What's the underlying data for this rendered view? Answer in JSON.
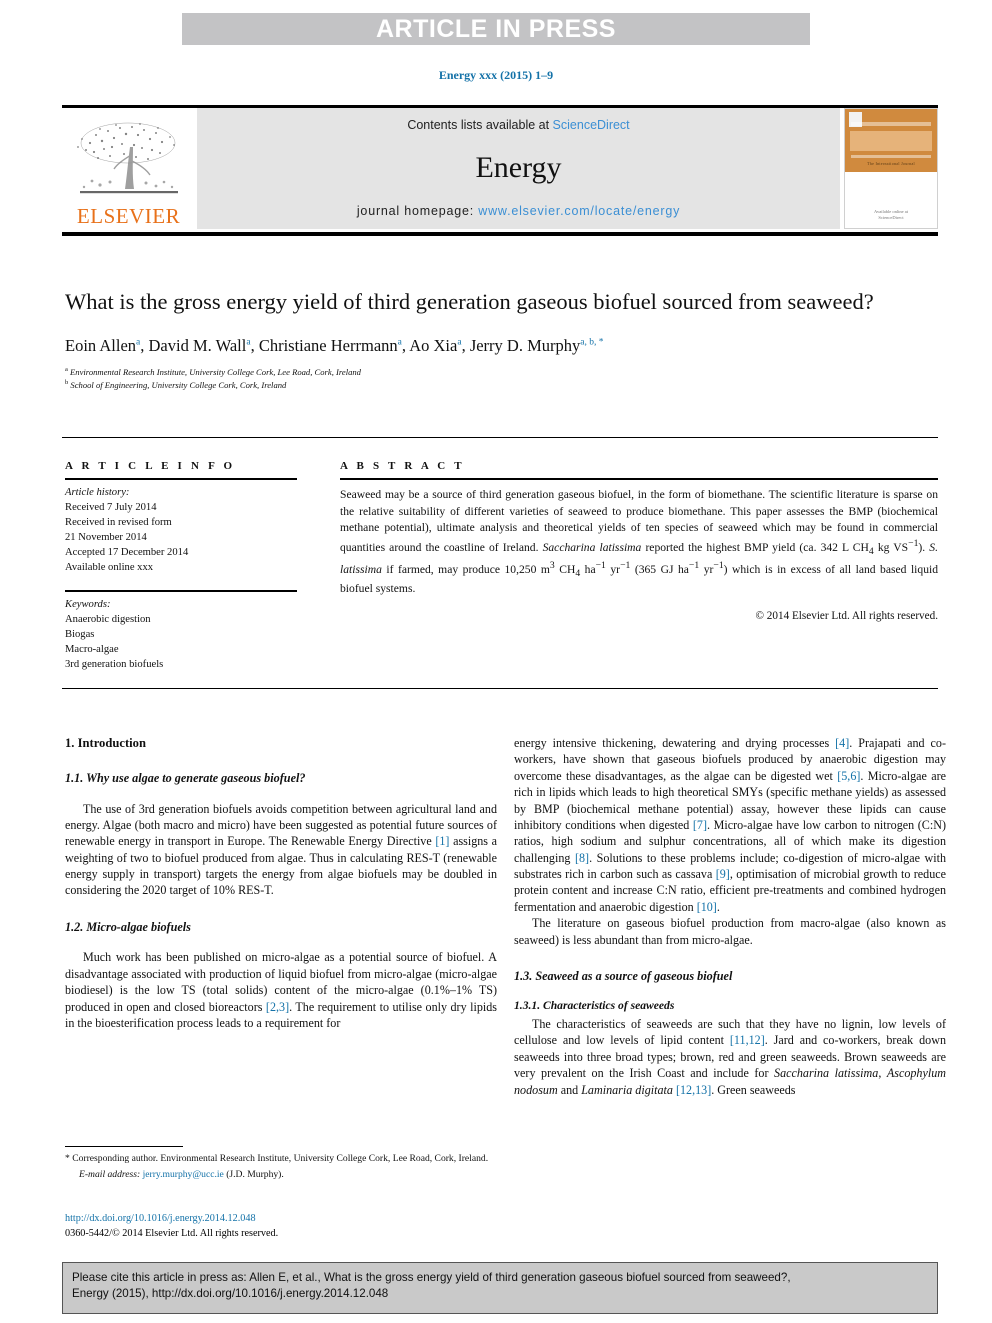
{
  "banner": {
    "label": "ARTICLE IN PRESS"
  },
  "running_head": {
    "text": "Energy xxx (2015) 1–9",
    "color": "#1472a8"
  },
  "masthead": {
    "publisher": "ELSEVIER",
    "publisher_color": "#e8711a",
    "contents_prefix": "Contents lists available at ",
    "contents_link": "ScienceDirect",
    "journal_title": "Energy",
    "homepage_prefix": "journal homepage: ",
    "homepage_url": "www.elsevier.com/locate/energy",
    "link_color": "#3b8fd4",
    "cover": {
      "title": "ENERGY",
      "caption": "The International Journal",
      "publisher_line": "Available online at",
      "publisher_line2": "ScienceDirect",
      "bg_color": "#d08a3e"
    }
  },
  "article": {
    "title": "What is the gross energy yield of third generation gaseous biofuel sourced from seaweed?",
    "authors": [
      {
        "name": "Eoin Allen",
        "marks": "a"
      },
      {
        "name": "David M. Wall",
        "marks": "a"
      },
      {
        "name": "Christiane Herrmann",
        "marks": "a"
      },
      {
        "name": "Ao Xia",
        "marks": "a"
      },
      {
        "name": "Jerry D. Murphy",
        "marks": "a, b, *"
      }
    ],
    "affiliations": [
      {
        "mark": "a",
        "text": "Environmental Research Institute, University College Cork, Lee Road, Cork, Ireland"
      },
      {
        "mark": "b",
        "text": "School of Engineering, University College Cork, Cork, Ireland"
      }
    ]
  },
  "info": {
    "heading": "A R T I C L E  I N F O",
    "history_label": "Article history:",
    "history": [
      "Received 7 July 2014",
      "Received in revised form",
      "21 November 2014",
      "Accepted 17 December 2014",
      "Available online xxx"
    ],
    "keywords_label": "Keywords:",
    "keywords": [
      "Anaerobic digestion",
      "Biogas",
      "Macro-algae",
      "3rd generation biofuels"
    ]
  },
  "abstract": {
    "heading": "A B S T R A C T",
    "paragraph_1": "Seaweed may be a source of third generation gaseous biofuel, in the form of biomethane. The scientific literature is sparse on the relative suitability of different varieties of seaweed to produce biomethane. This paper assesses the BMP (biochemical methane potential), ultimate analysis and theoretical yields of ten species of seaweed which may be found in commercial quantities around the coastline of Ireland. ",
    "species_1": "Saccharina latissima",
    "paragraph_2": " reported the highest BMP yield (ca. 342 L CH",
    "sub_4a": "4",
    "paragraph_3": " kg VS",
    "sup_m1a": "−1",
    "paragraph_4": "). ",
    "species_2": "S. latissima",
    "paragraph_5": " if farmed, may produce 10,250 m",
    "sup_3": "3",
    "paragraph_6": " CH",
    "sub_4b": "4",
    "paragraph_7": " ha",
    "sup_m1b": "−1",
    "paragraph_8": " yr",
    "sup_m1c": "−1",
    "paragraph_9": " (365 GJ ha",
    "sup_m1d": "−1",
    "paragraph_10": " yr",
    "sup_m1e": "−1",
    "paragraph_11": ") which is in excess of all land based liquid biofuel systems.",
    "copyright": "© 2014 Elsevier Ltd. All rights reserved."
  },
  "body": {
    "left": {
      "h1": "1. Introduction",
      "h2_1": "1.1. Why use algae to generate gaseous biofuel?",
      "p1_a": "The use of 3rd generation biofuels avoids competition between agricultural land and energy. Algae (both macro and micro) have been suggested as potential future sources of renewable energy in transport in Europe. The Renewable Energy Directive ",
      "p1_ref": "[1]",
      "p1_b": " assigns a weighting of two to biofuel produced from algae. Thus in calculating RES-T (renewable energy supply in transport) targets the energy from algae biofuels may be doubled in considering the 2020 target of 10% RES-T.",
      "h2_2": "1.2. Micro-algae biofuels",
      "p2_a": "Much work has been published on micro-algae as a potential source of biofuel. A disadvantage associated with production of liquid biofuel from micro-algae (micro-algae biodiesel) is the low TS (total solids) content of the micro-algae (0.1%–1% TS) produced in open and closed bioreactors ",
      "p2_ref": "[2,3]",
      "p2_b": ". The requirement to utilise only dry lipids in the bioesterification process leads to a requirement for"
    },
    "right": {
      "p3_a": "energy intensive thickening, dewatering and drying processes ",
      "p3_ref1": "[4]",
      "p3_b": ". Prajapati and co-workers, have shown that gaseous biofuels produced by anaerobic digestion may overcome these disadvantages, as the algae can be digested wet ",
      "p3_ref2": "[5,6]",
      "p3_c": ". Micro-algae are rich in lipids which leads to high theoretical SMYs (specific methane yields) as assessed by BMP (biochemical methane potential) assay, however these lipids can cause inhibitory conditions when digested ",
      "p3_ref3": "[7]",
      "p3_d": ". Micro-algae have low carbon to nitrogen (C:N) ratios, high sodium and sulphur concentrations, all of which make its digestion challenging ",
      "p3_ref4": "[8]",
      "p3_e": ". Solutions to these problems include; co-digestion of micro-algae with substrates rich in carbon such as cassava ",
      "p3_ref5": "[9]",
      "p3_f": ", optimisation of microbial growth to reduce protein content and increase C:N ratio, efficient pre-treatments and combined hydrogen fermentation and anaerobic digestion ",
      "p3_ref6": "[10]",
      "p3_g": ".",
      "p4": "The literature on gaseous biofuel production from macro-algae (also known as seaweed) is less abundant than from micro-algae.",
      "h2_3": "1.3. Seaweed as a source of gaseous biofuel",
      "h3_1": "1.3.1. Characteristics of seaweeds",
      "p5_a": "The characteristics of seaweeds are such that they have no lignin, low levels of cellulose and low levels of lipid content ",
      "p5_ref1": "[11,12]",
      "p5_b": ". Jard and co-workers, break down seaweeds into three broad types; brown, red and green seaweeds. Brown seaweeds are very prevalent on the Irish Coast and include for ",
      "p5_sp1": "Saccharina latissima",
      "p5_c": ", ",
      "p5_sp2": "Ascophylum nodosum",
      "p5_d": " and ",
      "p5_sp3": "Laminaria digitata",
      "p5_e": " ",
      "p5_ref2": "[12,13]",
      "p5_f": ". Green seaweeds"
    }
  },
  "footnote": {
    "star": "*",
    "corresponding": " Corresponding author. Environmental Research Institute, University College Cork, Lee Road, Cork, Ireland.",
    "email_label": "E-mail address:",
    "email": "jerry.murphy@ucc.ie",
    "email_owner": "(J.D. Murphy)."
  },
  "doi_block": {
    "doi_url": "http://dx.doi.org/10.1016/j.energy.2014.12.048",
    "issn_line": "0360-5442/© 2014 Elsevier Ltd. All rights reserved."
  },
  "cite_box": {
    "line1": "Please cite this article in press as: Allen E, et al., What is the gross energy yield of third generation gaseous biofuel sourced from seaweed?,",
    "line2": "Energy (2015), http://dx.doi.org/10.1016/j.energy.2014.12.048"
  }
}
